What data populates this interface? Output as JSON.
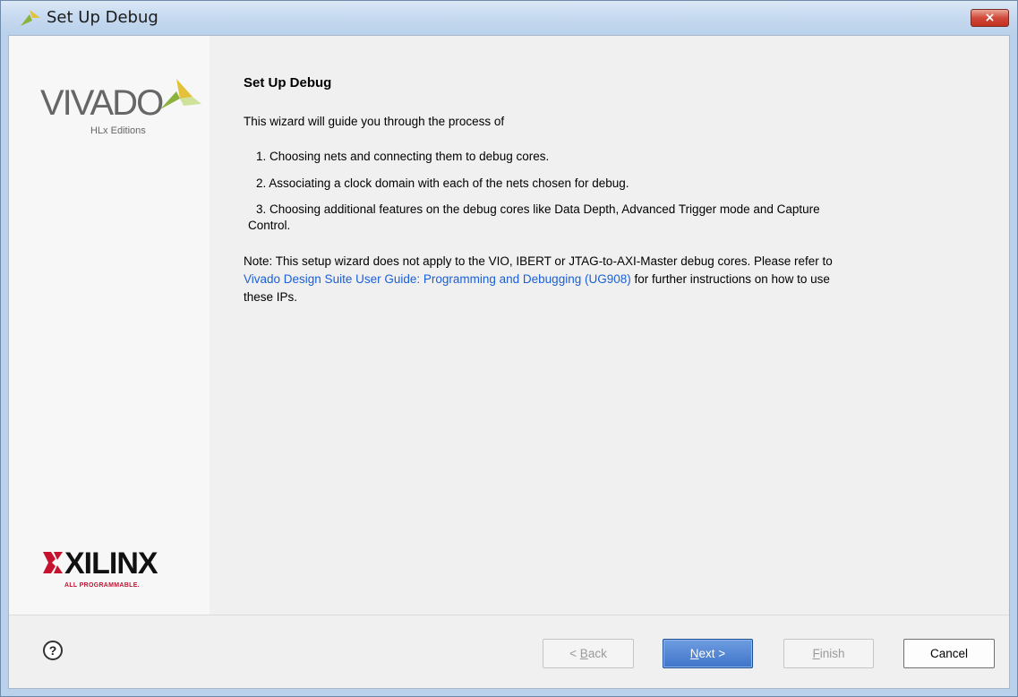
{
  "window": {
    "title": "Set Up Debug",
    "close_glyph": "×"
  },
  "sidebar": {
    "vivado_logo_text": "VIVADO",
    "vivado_edition_text": "HLx Editions",
    "xilinx_logo_text": "XILINX",
    "xilinx_tagline": "ALL PROGRAMMABLE."
  },
  "content": {
    "heading": "Set Up Debug",
    "intro": "This wizard will guide you through the process of",
    "steps": [
      "1.  Choosing nets and connecting them to debug cores.",
      "2.  Associating a clock domain with each of the nets chosen for debug.",
      "3.  Choosing additional features on the debug cores like Data Depth, Advanced Trigger mode and Capture",
      "Control."
    ],
    "note_line1": "Note: This setup wizard does not apply to the VIO, IBERT or JTAG-to-AXI-Master debug cores. Please refer to",
    "note_link": "Vivado Design Suite User Guide: Programming and Debugging (UG908)",
    "note_line2_rest": " for further instructions on how to use",
    "note_line3": "these IPs."
  },
  "footer": {
    "help_glyph": "?",
    "back_prefix": "< ",
    "back_u": "B",
    "back_rest": "ack",
    "next_u": "N",
    "next_rest": "ext >",
    "finish_u": "F",
    "finish_rest": "inish",
    "cancel": "Cancel"
  },
  "colors": {
    "link": "#1a5fd8",
    "primary_button": "#3f74c9",
    "close_button": "#c2301f",
    "xilinx_red": "#c4122f"
  },
  "icons": {
    "title": "vivado-icon",
    "close": "close-icon",
    "help": "help-icon"
  }
}
